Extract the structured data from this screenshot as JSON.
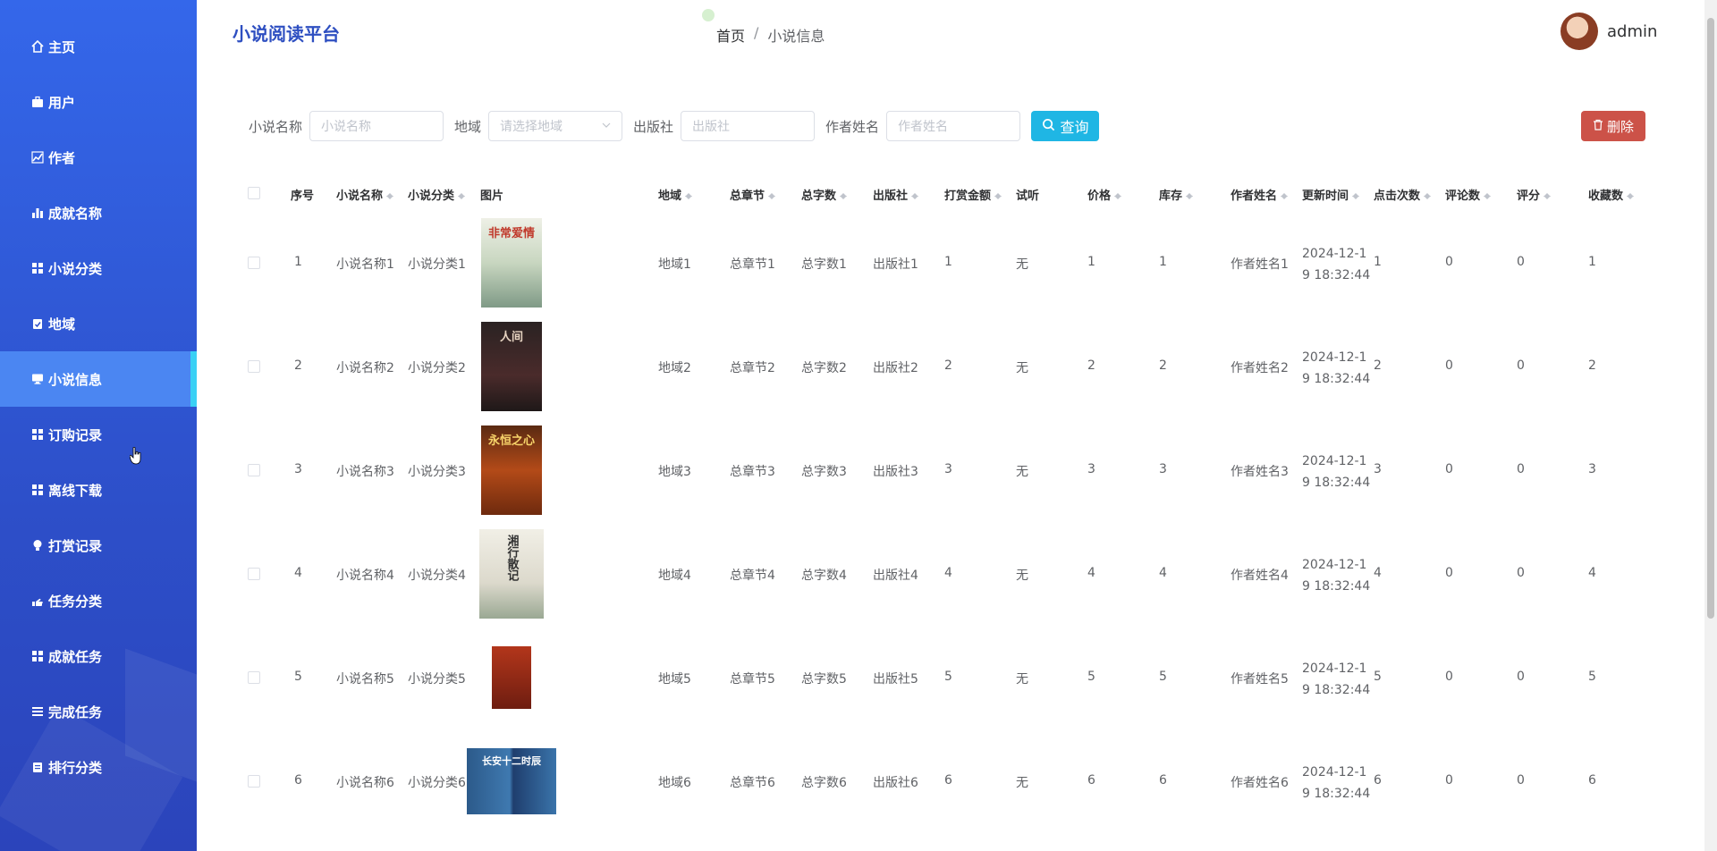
{
  "sidebar": {
    "items": [
      {
        "label": "主页",
        "icon": "home-icon"
      },
      {
        "label": "用户",
        "icon": "briefcase-icon"
      },
      {
        "label": "作者",
        "icon": "chart-line-icon"
      },
      {
        "label": "成就名称",
        "icon": "bar-chart-icon"
      },
      {
        "label": "小说分类",
        "icon": "grid-icon"
      },
      {
        "label": "地域",
        "icon": "clipboard-check-icon"
      },
      {
        "label": "小说信息",
        "icon": "monitor-icon"
      },
      {
        "label": "订购记录",
        "icon": "grid-icon"
      },
      {
        "label": "离线下载",
        "icon": "grid-icon"
      },
      {
        "label": "打赏记录",
        "icon": "lightbulb-icon"
      },
      {
        "label": "任务分类",
        "icon": "hand-icon"
      },
      {
        "label": "成就任务",
        "icon": "grid-icon"
      },
      {
        "label": "完成任务",
        "icon": "list-icon"
      },
      {
        "label": "排行分类",
        "icon": "clipboard-icon"
      }
    ],
    "active_label": "小说信息"
  },
  "header": {
    "brand": "小说阅读平台",
    "breadcrumb_home": "首页",
    "breadcrumb_sep": "/",
    "breadcrumb_current": "小说信息",
    "username": "admin"
  },
  "search": {
    "name_label": "小说名称",
    "name_placeholder": "小说名称",
    "region_label": "地域",
    "region_placeholder": "请选择地域",
    "publisher_label": "出版社",
    "publisher_placeholder": "出版社",
    "author_label": "作者姓名",
    "author_placeholder": "作者姓名",
    "query_label": "查询",
    "delete_label": "删除"
  },
  "table": {
    "headers": [
      "序号",
      "小说名称",
      "小说分类",
      "图片",
      "地域",
      "总章节",
      "总字数",
      "出版社",
      "打赏金额",
      "试听",
      "价格",
      "库存",
      "作者姓名",
      "更新时间",
      "点击次数",
      "评论数",
      "评分",
      "收藏数"
    ],
    "rows": [
      {
        "no": "1",
        "name": "小说名称1",
        "category": "小说分类1",
        "cover_title": "非常爱情",
        "region": "地域1",
        "chapters": "总章节1",
        "words": "总字数1",
        "publisher": "出版社1",
        "reward": "1",
        "audition": "无",
        "price": "1",
        "stock": "1",
        "author": "作者姓名1",
        "time1": "2024-12-1",
        "time2": "9 18:32:44",
        "clicks": "1",
        "comments": "0",
        "score": "0",
        "favorites": "1"
      },
      {
        "no": "2",
        "name": "小说名称2",
        "category": "小说分类2",
        "cover_title": "人间",
        "region": "地域2",
        "chapters": "总章节2",
        "words": "总字数2",
        "publisher": "出版社2",
        "reward": "2",
        "audition": "无",
        "price": "2",
        "stock": "2",
        "author": "作者姓名2",
        "time1": "2024-12-1",
        "time2": "9 18:32:44",
        "clicks": "2",
        "comments": "0",
        "score": "0",
        "favorites": "2"
      },
      {
        "no": "3",
        "name": "小说名称3",
        "category": "小说分类3",
        "cover_title": "永恒之心",
        "region": "地域3",
        "chapters": "总章节3",
        "words": "总字数3",
        "publisher": "出版社3",
        "reward": "3",
        "audition": "无",
        "price": "3",
        "stock": "3",
        "author": "作者姓名3",
        "time1": "2024-12-1",
        "time2": "9 18:32:44",
        "clicks": "3",
        "comments": "0",
        "score": "0",
        "favorites": "3"
      },
      {
        "no": "4",
        "name": "小说名称4",
        "category": "小说分类4",
        "cover_title": "湘行散记",
        "region": "地域4",
        "chapters": "总章节4",
        "words": "总字数4",
        "publisher": "出版社4",
        "reward": "4",
        "audition": "无",
        "price": "4",
        "stock": "4",
        "author": "作者姓名4",
        "time1": "2024-12-1",
        "time2": "9 18:32:44",
        "clicks": "4",
        "comments": "0",
        "score": "0",
        "favorites": "4"
      },
      {
        "no": "5",
        "name": "小说名称5",
        "category": "小说分类5",
        "cover_title": "",
        "region": "地域5",
        "chapters": "总章节5",
        "words": "总字数5",
        "publisher": "出版社5",
        "reward": "5",
        "audition": "无",
        "price": "5",
        "stock": "5",
        "author": "作者姓名5",
        "time1": "2024-12-1",
        "time2": "9 18:32:44",
        "clicks": "5",
        "comments": "0",
        "score": "0",
        "favorites": "5"
      },
      {
        "no": "6",
        "name": "小说名称6",
        "category": "小说分类6",
        "cover_title": "长安十二时辰",
        "region": "地域6",
        "chapters": "总章节6",
        "words": "总字数6",
        "publisher": "出版社6",
        "reward": "6",
        "audition": "无",
        "price": "6",
        "stock": "6",
        "author": "作者姓名6",
        "time1": "2024-12-1",
        "time2": "9 18:32:44",
        "clicks": "6",
        "comments": "0",
        "score": "0",
        "favorites": "6"
      }
    ]
  },
  "colors": {
    "sidebar_top": "#3467ea",
    "sidebar_bottom": "#2b44bb",
    "active_item": "#4b86f2",
    "active_bar": "#3ad0f5",
    "query_button": "#1fb6e4",
    "delete_button": "#cc5248",
    "brand": "#2e4fc1"
  }
}
